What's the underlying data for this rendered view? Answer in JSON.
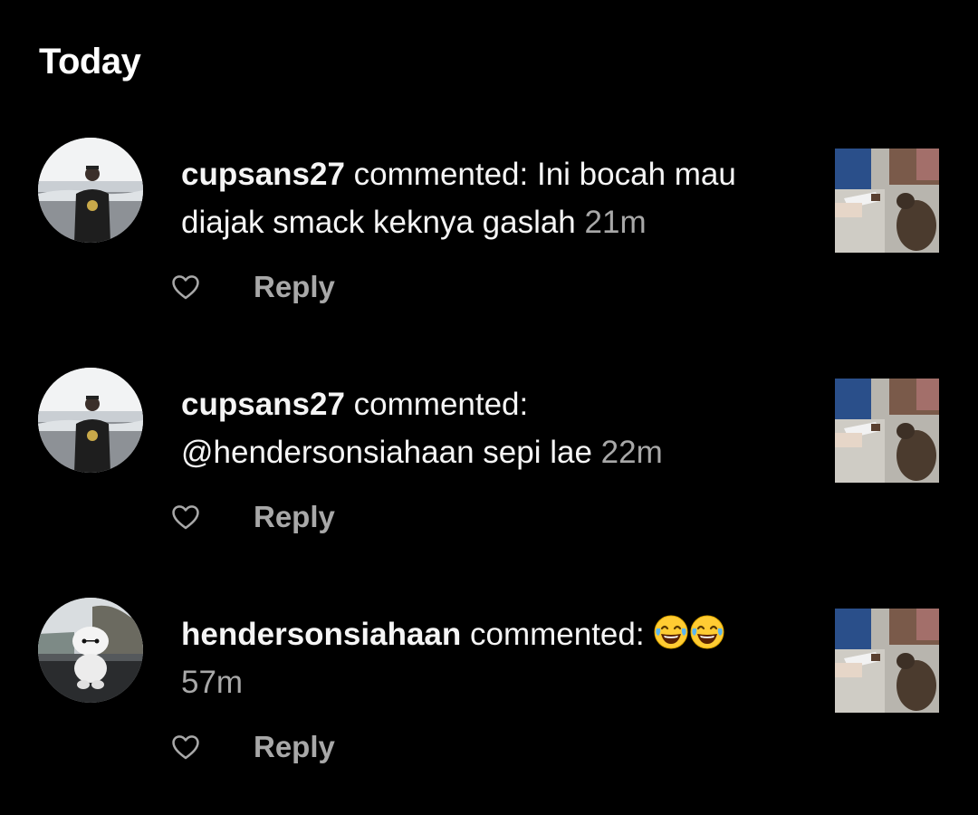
{
  "section": {
    "title": "Today"
  },
  "notifications": [
    {
      "username": "cupsans27",
      "action": " commented: ",
      "comment": "Ini bocah mau diajak smack keknya gaslah",
      "time": "21m",
      "reply_label": "Reply",
      "avatar_icon": "person-at-beach-avatar",
      "thumbnail_icon": "cat-post-thumbnail"
    },
    {
      "username": "cupsans27",
      "action": " commented: ",
      "comment": "@hendersonsiahaan sepi lae",
      "time": "22m",
      "reply_label": "Reply",
      "avatar_icon": "person-at-beach-avatar",
      "thumbnail_icon": "cat-post-thumbnail"
    },
    {
      "username": "hendersonsiahaan",
      "action": " commented: ",
      "comment": "😂😂",
      "time": "57m",
      "reply_label": "Reply",
      "avatar_icon": "white-robot-figure-avatar",
      "thumbnail_icon": "cat-post-thumbnail"
    }
  ],
  "colors": {
    "background": "#000000",
    "text": "#f5f5f5",
    "muted": "#a8a8a8"
  }
}
